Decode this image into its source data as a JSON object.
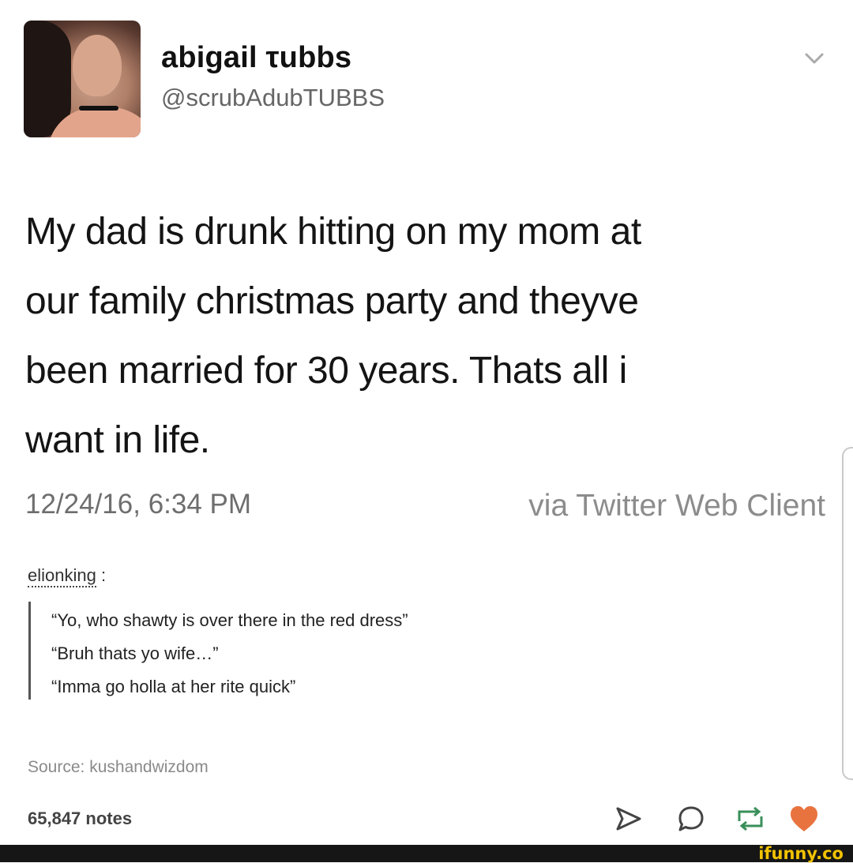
{
  "tweet": {
    "display_name": "abigail τubbs",
    "handle": "@scrubAdubTUBBS",
    "text_lines": [
      "My dad is drunk hitting on my mom at",
      "our family christmas party and theyve",
      "been married for 30 years. Thats all i",
      "want in life."
    ],
    "timestamp": "12/24/16, 6:34 PM",
    "via": "via Twitter Web Client"
  },
  "post": {
    "reblogger": "elionking",
    "reblogger_suffix": ":",
    "quotes": [
      "“Yo, who shawty is over there in the red dress”",
      "“Bruh thats yo wife…”",
      "“Imma go holla at her rite quick”"
    ],
    "source": "Source: kushandwizdom",
    "notes": "65,847 notes"
  },
  "icons": {
    "share": "share-icon",
    "reply": "reply-icon",
    "reblog": "reblog-icon",
    "like": "heart-icon",
    "chevron": "chevron-down-icon"
  },
  "colors": {
    "like": "#e8733f",
    "watermark": "#f2c200"
  },
  "watermark": "ifunny.co"
}
